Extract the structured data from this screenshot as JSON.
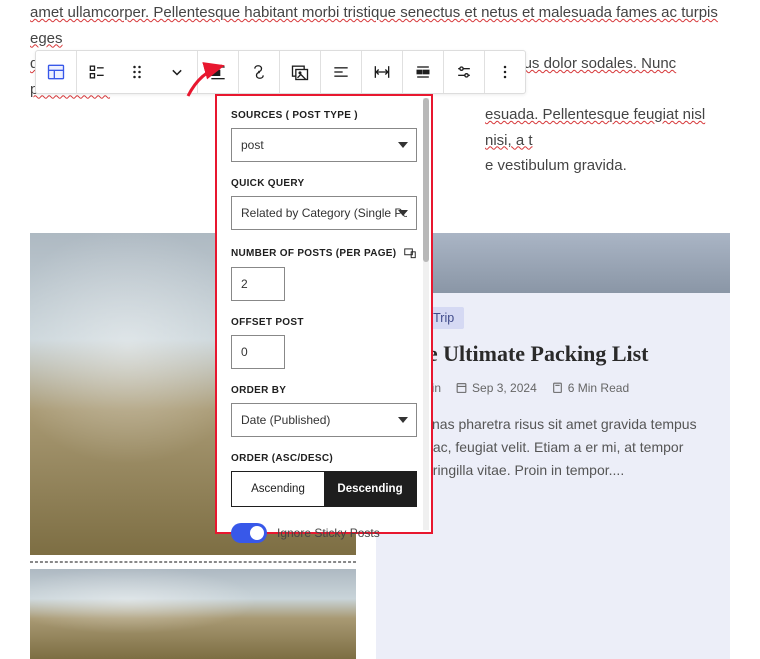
{
  "doc": {
    "line1": "amet ullamcorper. Pellentesque habitant morbi tristique senectus et netus et malesuada fames ac turpis eges",
    "line2": "dapibus in, semper id nisl. Praesent sagittis quam non est rutrum, eu tempus dolor sodales. Nunc porttitor tem",
    "line3_tail": "esuada. Pellentesque feugiat nisl nisi, a t",
    "line4_tail": "e vestibulum gravida."
  },
  "toolbar_icons": [
    "list-block",
    "list-view",
    "drag",
    "align-full",
    "query-loop",
    "gallery",
    "text-align",
    "width",
    "grid",
    "settings",
    "more"
  ],
  "popover": {
    "sources_label": "SOURCES ( POST TYPE )",
    "sources_value": "post",
    "quick_query_label": "QUICK QUERY",
    "quick_query_value": "Related by Category (Single Post)",
    "num_posts_label": "NUMBER OF POSTS (PER PAGE)",
    "num_posts_value": "2",
    "offset_label": "OFFSET POST",
    "offset_value": "0",
    "orderby_label": "ORDER BY",
    "orderby_value": "Date (Published)",
    "order_label": "ORDER (ASC/DESC)",
    "asc": "Ascending",
    "desc": "Descending",
    "sticky_label": "Ignore Sticky Posts"
  },
  "card2": {
    "badge": "Road Trip",
    "title": "“The Ultimate Packing List",
    "author": "Admin",
    "date": "Sep 3, 2024",
    "read": "6 Min Read",
    "excerpt": "Maecenas pharetra risus sit amet gravida tempus neque ac, feugiat velit. Etiam a er mi, at tempor lorem fringilla vitae. Proin in tempor...."
  }
}
